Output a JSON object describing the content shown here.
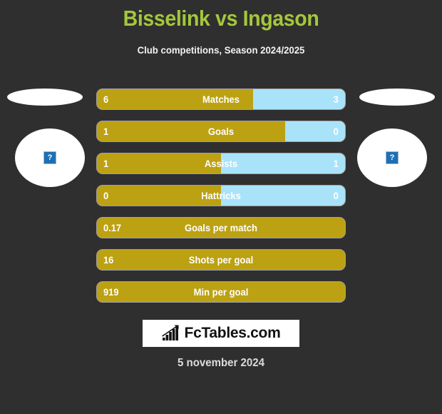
{
  "header": {
    "title": "Bisselink vs Ingason",
    "subtitle": "Club competitions, Season 2024/2025",
    "title_color": "#a4c73c"
  },
  "players": {
    "home": {
      "name": "",
      "photo_icon": "broken-image-icon",
      "photo_glyph": "?"
    },
    "away": {
      "name": "",
      "photo_icon": "broken-image-icon",
      "photo_glyph": "?"
    }
  },
  "colors": {
    "background": "#2f2f2f",
    "home_bar": "#bca113",
    "away_bar": "#a9e3fa",
    "text": "#ffffff"
  },
  "chart_data": {
    "type": "bar",
    "title": "Bisselink vs Ingason",
    "subtitle": "Club competitions, Season 2024/2025",
    "orientation": "horizontal-diverging",
    "series": [
      {
        "name": "Bisselink",
        "color": "#bca113"
      },
      {
        "name": "Ingason",
        "color": "#a9e3fa"
      }
    ],
    "categories": [
      "Matches",
      "Goals",
      "Assists",
      "Hattricks",
      "Goals per match",
      "Shots per goal",
      "Min per goal"
    ],
    "rows": [
      {
        "label": "Matches",
        "home_value": "6",
        "away_value": "3",
        "home_pct": 63,
        "away_pct": 37,
        "has_away": true
      },
      {
        "label": "Goals",
        "home_value": "1",
        "away_value": "0",
        "home_pct": 76,
        "away_pct": 24,
        "has_away": true
      },
      {
        "label": "Assists",
        "home_value": "1",
        "away_value": "1",
        "home_pct": 50,
        "away_pct": 50,
        "has_away": true
      },
      {
        "label": "Hattricks",
        "home_value": "0",
        "away_value": "0",
        "home_pct": 50,
        "away_pct": 50,
        "has_away": true
      },
      {
        "label": "Goals per match",
        "home_value": "0.17",
        "away_value": "",
        "home_pct": 100,
        "away_pct": 0,
        "has_away": false
      },
      {
        "label": "Shots per goal",
        "home_value": "16",
        "away_value": "",
        "home_pct": 100,
        "away_pct": 0,
        "has_away": false
      },
      {
        "label": "Min per goal",
        "home_value": "919",
        "away_value": "",
        "home_pct": 100,
        "away_pct": 0,
        "has_away": false
      }
    ]
  },
  "footer": {
    "logo_icon": "bar-chart-growth-icon",
    "logo_text": "FcTables.com",
    "date": "5 november 2024"
  }
}
